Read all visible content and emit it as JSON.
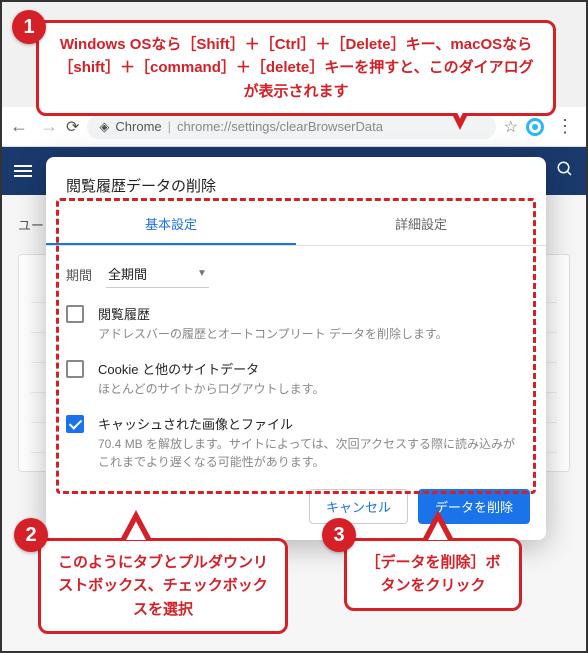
{
  "address_bar": {
    "app_label": "Chrome",
    "path": "chrome://settings/clearBrowserData"
  },
  "page": {
    "sidebar_label": "ユー"
  },
  "dialog": {
    "title": "閲覧履歴データの削除",
    "tabs": {
      "basic": "基本設定",
      "advanced": "詳細設定"
    },
    "period": {
      "label": "期間",
      "value": "全期間"
    },
    "options": [
      {
        "checked": false,
        "title": "閲覧履歴",
        "desc": "アドレスバーの履歴とオートコンプリート データを削除します。"
      },
      {
        "checked": false,
        "title": "Cookie と他のサイトデータ",
        "desc": "ほとんどのサイトからログアウトします。"
      },
      {
        "checked": true,
        "title": "キャッシュされた画像とファイル",
        "desc": "70.4 MB を解放します。サイトによっては、次回アクセスする際に読み込みがこれまでより遅くなる可能性があります。"
      }
    ],
    "actions": {
      "cancel": "キャンセル",
      "confirm": "データを削除"
    }
  },
  "callouts": {
    "c1": "Windows OSなら［Shift］＋［Ctrl］＋［Delete］キー、macOSなら［shift］＋［command］＋［delete］キーを押すと、このダイアログが表示されます",
    "c2": "このようにタブとプルダウンリストボックス、チェックボックスを選択",
    "c3": "［データを削除］ボタンをクリック",
    "n1": "1",
    "n2": "2",
    "n3": "3"
  }
}
